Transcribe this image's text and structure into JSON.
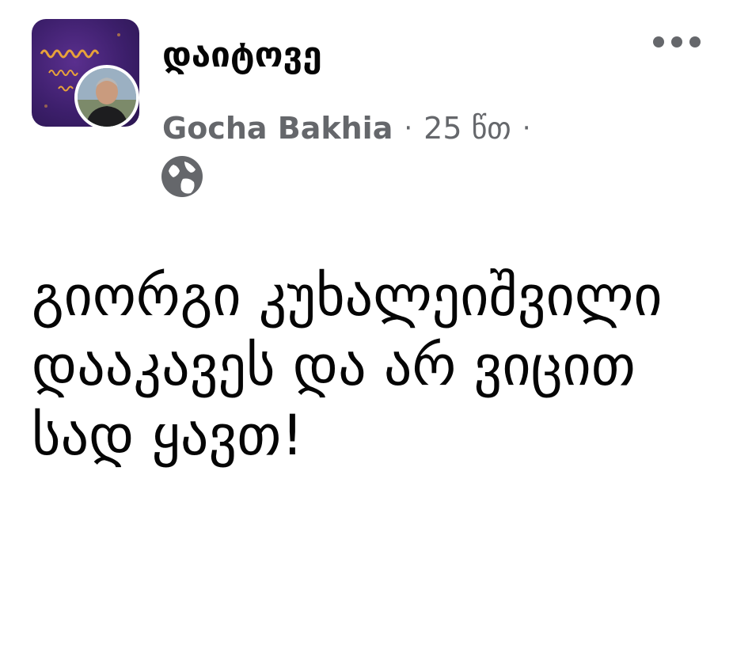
{
  "post": {
    "group_name": "დაიტოვე",
    "author": "Gocha Bakhia",
    "separator": "·",
    "time": "25 წთ",
    "separator_end": "·",
    "privacy_icon": "globe-icon",
    "more_icon": "more-options-icon",
    "text": "გიორგი კუხალეიშვილი დააკავეს და არ ვიცით სად ყავთ!"
  },
  "colors": {
    "text": "#050505",
    "meta": "#65676b",
    "group_avatar_bg": "#3d1f6c",
    "group_avatar_lettering": "#e8a23a"
  }
}
